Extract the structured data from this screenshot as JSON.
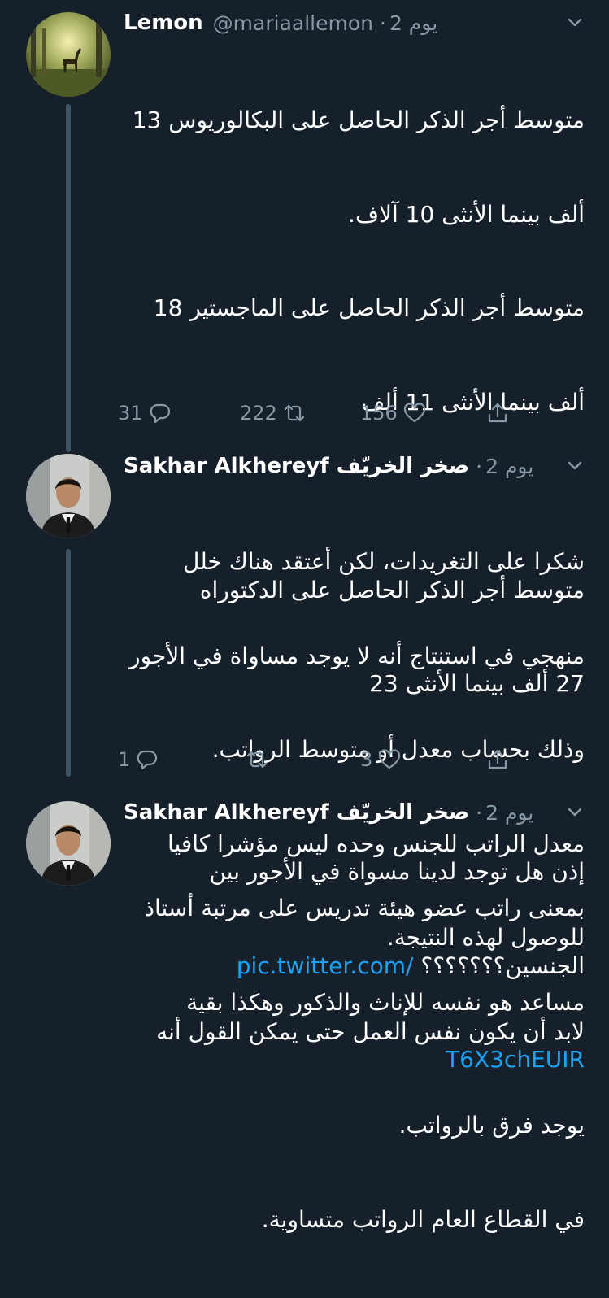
{
  "tweets": [
    {
      "name": "Lemon",
      "handle": "@mariaallemon",
      "time": "2 يوم",
      "avatar": "deer-in-forest-avatar",
      "lines": [
        "متوسط أجر الذكر الحاصل على البكالوريوس 13",
        "ألف بينما الأنثى 10 آلاف.",
        "متوسط أجر الذكر الحاصل على الماجستير 18",
        "ألف بينما الأنثى 11 ألف",
        "",
        "متوسط أجر الذكر الحاصل على الدكتوراه",
        "27 ألف بينما الأنثى 23",
        "",
        "إذن هل توجد لدينا مسواة في الأجور بين"
      ],
      "last_line_text": "الجنسين؟؟؟؟؟؟؟",
      "link_part1": "pic.twitter.com/",
      "link_part2": "T6X3chEUIR",
      "replies": "31",
      "retweets": "222",
      "likes": "156"
    },
    {
      "name": "Sakhar Alkhereyf صخر الخريّف",
      "time": "2 يوم",
      "avatar": "man-in-suit-avatar",
      "lines": [
        "شكرا على التغريدات، لكن أعتقد هناك خلل",
        "منهجي في استنتاج أنه لا يوجد مساواة في الأجور",
        "وذلك بحساب معدل أو متوسط الرواتب.",
        "معدل الراتب للجنس وحده ليس مؤشرا كافيا",
        "للوصول لهذه النتيجة.",
        "لابد أن يكون نفس العمل حتى يمكن القول أنه",
        "يوجد فرق بالرواتب.",
        "في القطاع العام الرواتب متساوية."
      ],
      "replies": "1",
      "retweets": "",
      "likes": "3"
    },
    {
      "name": "Sakhar Alkhereyf صخر الخريّف",
      "time": "2 يوم",
      "avatar": "man-in-suit-avatar",
      "lines": [
        "بمعنى راتب عضو هيئة تدريس على مرتبة أستاذ",
        "مساعد هو نفسه للإناث والذكور وهكذا بقية"
      ]
    }
  ],
  "colors": {
    "background": "#15202b",
    "text": "#ffffff",
    "muted": "#8899a6",
    "link": "#1da1f2",
    "thread_line": "#3d5466"
  }
}
